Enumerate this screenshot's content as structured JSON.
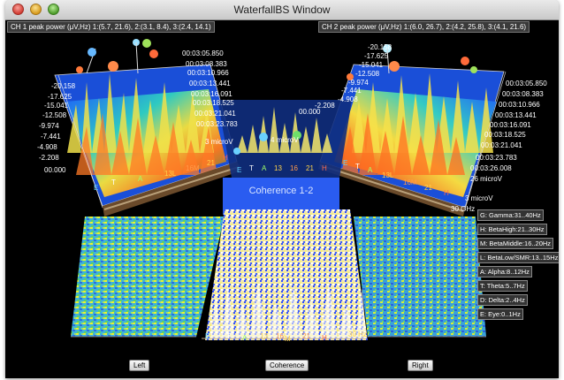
{
  "window": {
    "title": "WaterfallBS Window"
  },
  "ch1_peak": "CH 1 peak power (μV,Hz) 1:(5.7, 21.6), 2:(3.1, 8.4), 3:(2.4, 14.1)",
  "ch2_peak": "CH 2 peak power (μV,Hz) 1:(6.0, 26.7), 2:(4.2, 25.8), 3:(4.1, 21.6)",
  "coherence_label": "Coherence 1-2",
  "left_panel": {
    "values": [
      "-20.158",
      "-17.625",
      "-15.041",
      "-12.508",
      "-9.974",
      "-7.441",
      "-4.908",
      "-2.208",
      "00.000"
    ],
    "times": [
      "00:03:05.850",
      "00:03:08.383",
      "00:03:10.966",
      "00:03:13.441",
      "00:03:16.091",
      "00:03:18.525",
      "00:03:21.041",
      "00:03:23.783"
    ],
    "micro_label": "3 microV",
    "bands": [
      "E",
      "T",
      "A",
      "13L",
      "16M",
      "21",
      "H"
    ],
    "zero": "00.000"
  },
  "right_panel": {
    "values": [
      "-20.158",
      "-17.625",
      "-15.041",
      "-12.508",
      "-9.974",
      "-7.441",
      "-4.908",
      "-2.208",
      "00.000"
    ],
    "times": [
      "00:03:05.850",
      "00:03:08.383",
      "00:03:10.966",
      "00:03:13.441",
      "00:03:16.091",
      "00:03:18.525",
      "00:03:21.041",
      "00:03:23.783",
      "00:03:26.008"
    ],
    "micro_top": "26 microV",
    "micro_bottom": "3 microV",
    "axis_end": "30 GHz",
    "bands": [
      "E",
      "T",
      "A",
      "13L",
      "16M",
      "21",
      "H"
    ]
  },
  "center": {
    "micro": "4 microV",
    "bands": [
      "E",
      "T",
      "A",
      "13",
      "16",
      "21",
      "H"
    ]
  },
  "bottom_axis": {
    "bands": [
      "E",
      "T",
      "A",
      "13",
      "16",
      "M",
      "21",
      "H"
    ],
    "end": "30 Hz"
  },
  "legend": [
    "G: Gamma:31..40Hz",
    "H: BetaHigh:21..30Hz",
    "M: BetaMiddle:16..20Hz",
    "L: BetaLow/SMR:13..15Hz",
    "A: Alpha:8..12Hz",
    "T: Theta:5..7Hz",
    "D: Delta:2..4Hz",
    "E: Eye:0..1Hz"
  ],
  "buttons": {
    "left": "Left",
    "coherence": "Coherence",
    "right": "Right"
  }
}
